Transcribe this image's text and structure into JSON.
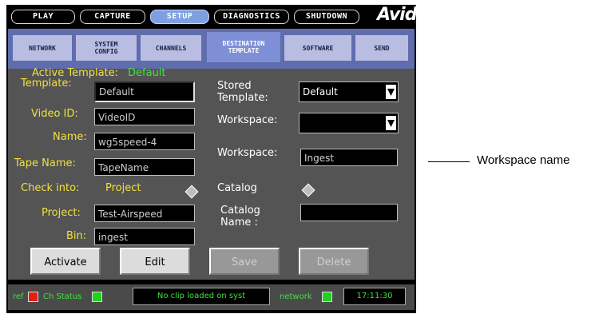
{
  "top_menu": [
    "PLAY",
    "CAPTURE",
    "SETUP",
    "DIAGNOSTICS",
    "SHUTDOWN"
  ],
  "logo": "Avid.",
  "tabs": [
    {
      "line1": "NETWORK",
      "line2": ""
    },
    {
      "line1": "SYSTEM",
      "line2": "CONFIG"
    },
    {
      "line1": "CHANNELS",
      "line2": ""
    },
    {
      "line1": "DESTINATION",
      "line2": "TEMPLATE"
    },
    {
      "line1": "SOFTWARE",
      "line2": ""
    },
    {
      "line1": "SEND",
      "line2": ""
    }
  ],
  "form": {
    "active_template_label": "Active Template:",
    "active_template_value": "Default",
    "template_label": "Template:",
    "template_value": "Default",
    "video_id_label": "Video ID:",
    "video_id_value": "VideoID",
    "name_label": "Name:",
    "name_value": "wg5speed-4",
    "tape_name_label": "Tape Name:",
    "tape_name_value": "TapeName",
    "check_into_label": "Check into:",
    "check_into_value": "Project",
    "project_label": "Project:",
    "project_value": "Test-Airspeed",
    "bin_label": "Bin:",
    "bin_value": "ingest",
    "stored_template_label_1": "Stored",
    "stored_template_label_2": "Template:",
    "stored_template_value": "Default",
    "workspace_select_label": "Workspace:",
    "workspace_select_value": "",
    "workspace_name_label": "Workspace:",
    "workspace_name_value": "Ingest",
    "catalog_label": "Catalog",
    "catalog_name_label_1": "Catalog",
    "catalog_name_label_2": "Name   :",
    "catalog_name_value": ""
  },
  "actions": {
    "activate": "Activate",
    "edit": "Edit",
    "save": "Save",
    "delete": "Delete"
  },
  "status": {
    "ref_label": "ref",
    "ch_status_label": "Ch Status",
    "message": "No clip loaded on syst",
    "network_label": "network",
    "time": "17:11:30",
    "ref_color": "#e02010",
    "ch_status_color": "#20d020",
    "network_color": "#20d020"
  },
  "callout": "Workspace name"
}
